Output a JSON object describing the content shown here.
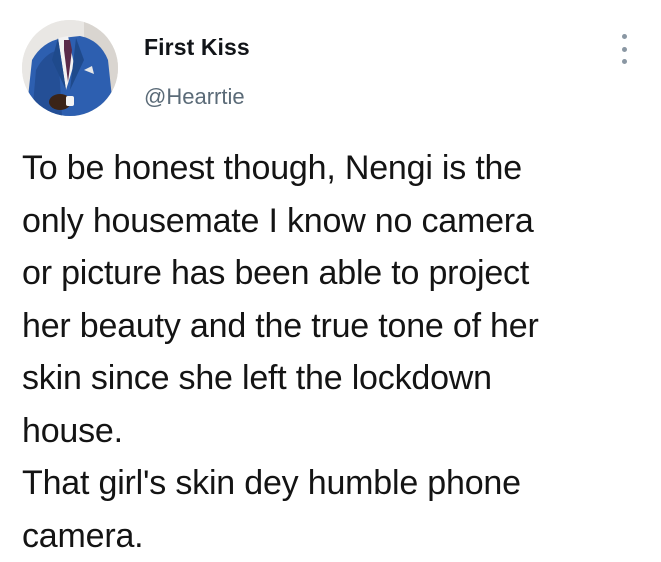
{
  "tweet": {
    "display_name": "First Kiss",
    "handle": "@Hearrtie",
    "text": "To be honest though, Nengi is the\nonly housemate I know no camera\nor picture has been able to project\nher beauty and the true tone of her\nskin since she left the lockdown\nhouse.\nThat girl's skin dey humble phone\ncamera.",
    "avatar_icon": "profile-photo-man-in-blue-suit",
    "more_icon": "vertical-ellipsis-icon"
  },
  "colors": {
    "name": "#111418",
    "handle": "#5b6b78",
    "text": "#141414",
    "menu_dots": "#8a97a3"
  }
}
